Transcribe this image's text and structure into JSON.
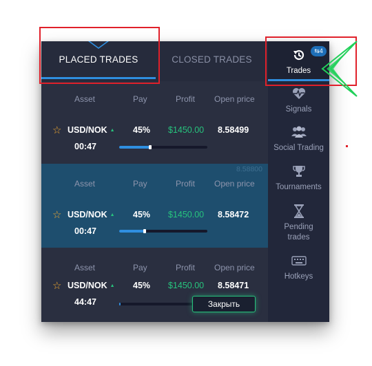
{
  "tabs": {
    "placed": "PLACED TRADES",
    "closed": "CLOSED TRADES"
  },
  "headers": {
    "asset": "Asset",
    "pay": "Pay",
    "profit": "Profit",
    "open_price": "Open price"
  },
  "trades": [
    {
      "pair": "USD/NOK",
      "pay": "45%",
      "profit": "$1450.00",
      "open_price": "8.58499",
      "time": "00:47",
      "progress": 0.35
    },
    {
      "pair": "USD/NOK",
      "pay": "45%",
      "profit": "$1450.00",
      "open_price": "8.58472",
      "time": "00:47",
      "progress": 0.29,
      "chart_value": "8.58800"
    },
    {
      "pair": "USD/NOK",
      "pay": "45%",
      "profit": "$1450.00",
      "open_price": "8.58471",
      "time": "44:47",
      "progress": 0.02,
      "close_label": "Закрыть"
    }
  ],
  "sidebar": {
    "trades": {
      "label": "Trades",
      "badge": "⇆4"
    },
    "signals": "Signals",
    "social": "Social Trading",
    "tournaments": "Tournaments",
    "pending": "Pending trades",
    "hotkeys": "Hotkeys"
  },
  "colors": {
    "accent": "#2f8fe0",
    "positive": "#27c37d",
    "highlight_row": "#1e4e6e",
    "annotation": "#e0202a",
    "arrow": "#22d05a"
  },
  "icons": [
    "star-icon",
    "trend-up-icon",
    "history-icon",
    "heartbeat-icon",
    "users-icon",
    "trophy-icon",
    "hourglass-icon",
    "keyboard-icon",
    "chevron-down-icon",
    "arrow-left-icon"
  ]
}
